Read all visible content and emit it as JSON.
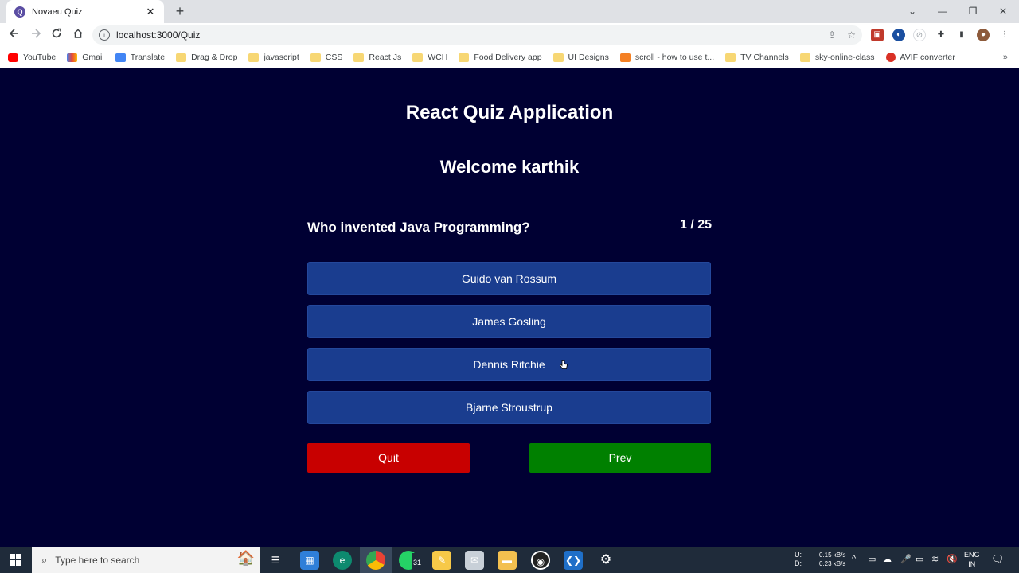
{
  "browser": {
    "tab_title": "Novaeu Quiz",
    "tab_close": "✕",
    "new_tab": "+",
    "url": "localhost:3000/Quiz",
    "bookmarks": [
      "YouTube",
      "Gmail",
      "Translate",
      "Drag & Drop",
      "javascript",
      "CSS",
      "React Js",
      "WCH",
      "Food Delivery app",
      "UI Designs",
      "scroll - how to use t...",
      "TV Channels",
      "sky-online-class",
      "AVIF converter"
    ],
    "bookmarks_more": "»"
  },
  "quiz": {
    "app_title": "React Quiz Application",
    "welcome": "Welcome karthik",
    "question": "Who invented Java Programming?",
    "counter": "1 / 25",
    "options": [
      "Guido van Rossum",
      "James Gosling",
      "Dennis Ritchie",
      "Bjarne Stroustrup"
    ],
    "quit_label": "Quit",
    "prev_label": "Prev",
    "colors": {
      "background": "#000033",
      "option": "#1a3d8f",
      "quit": "#c80000",
      "prev": "#008000"
    }
  },
  "taskbar": {
    "search_placeholder": "Type here to search",
    "whatsapp_badge": "31",
    "net_up_label": "U:",
    "net_down_label": "D:",
    "net_up": "0.15 kB/s",
    "net_down": "0.23 kB/s",
    "lang_line1": "ENG",
    "lang_line2": "IN"
  }
}
